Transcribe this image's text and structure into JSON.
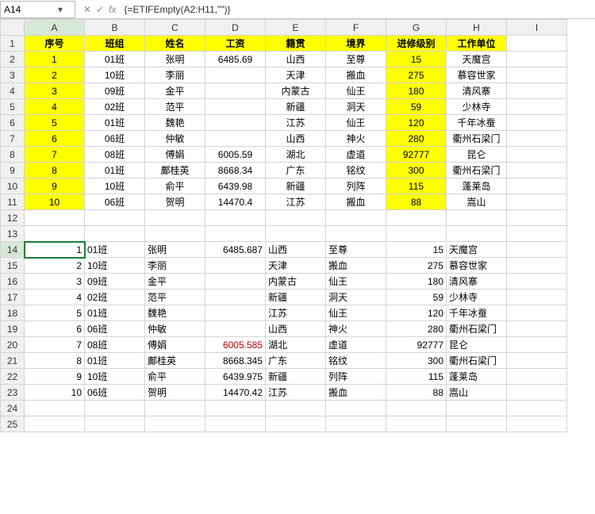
{
  "name_box": {
    "value": "A14"
  },
  "formula_bar": {
    "value": "{=ETIFEmpty(A2:H11,\"\")}"
  },
  "col_letters": [
    "A",
    "B",
    "C",
    "D",
    "E",
    "F",
    "G",
    "H",
    "I"
  ],
  "row_numbers": [
    "1",
    "2",
    "3",
    "4",
    "5",
    "6",
    "7",
    "8",
    "9",
    "10",
    "11",
    "12",
    "13",
    "14",
    "15",
    "16",
    "17",
    "18",
    "19",
    "20",
    "21",
    "22",
    "23",
    "24",
    "25"
  ],
  "header_row": [
    "序号",
    "班组",
    "姓名",
    "工资",
    "籍贯",
    "境界",
    "进修级别",
    "工作单位"
  ],
  "upper_rows": [
    [
      "1",
      "01班",
      "张明",
      "6485.69",
      "山西",
      "至尊",
      "15",
      "天魔宫"
    ],
    [
      "2",
      "10班",
      "李丽",
      "",
      "天津",
      "搬血",
      "275",
      "慕容世家"
    ],
    [
      "3",
      "09班",
      "金平",
      "",
      "内蒙古",
      "仙王",
      "180",
      "清风寨"
    ],
    [
      "4",
      "02班",
      "范平",
      "",
      "新疆",
      "洞天",
      "59",
      "少林寺"
    ],
    [
      "5",
      "01班",
      "魏艳",
      "",
      "江苏",
      "仙王",
      "120",
      "千年冰蚕"
    ],
    [
      "6",
      "06班",
      "仲敏",
      "",
      "山西",
      "神火",
      "280",
      "衢州石梁门"
    ],
    [
      "7",
      "08班",
      "傅娟",
      "6005.59",
      "湖北",
      "虚道",
      "92777",
      "昆仑"
    ],
    [
      "8",
      "01班",
      "鄺桂英",
      "8668.34",
      "广东",
      "铭纹",
      "300",
      "衢州石梁门"
    ],
    [
      "9",
      "10班",
      "俞平",
      "6439.98",
      "新疆",
      "列阵",
      "115",
      "蓬莱岛"
    ],
    [
      "10",
      "06班",
      "贺明",
      "14470.4",
      "江苏",
      "搬血",
      "88",
      "嵩山"
    ]
  ],
  "lower_rows": [
    [
      "1",
      "01班",
      "张明",
      "6485.687",
      "山西",
      "至尊",
      "15",
      "天魔宫"
    ],
    [
      "2",
      "10班",
      "李丽",
      "",
      "天津",
      "搬血",
      "275",
      "慕容世家"
    ],
    [
      "3",
      "09班",
      "金平",
      "",
      "内蒙古",
      "仙王",
      "180",
      "清风寨"
    ],
    [
      "4",
      "02班",
      "范平",
      "",
      "新疆",
      "洞天",
      "59",
      "少林寺"
    ],
    [
      "5",
      "01班",
      "魏艳",
      "",
      "江苏",
      "仙王",
      "120",
      "千年冰蚕"
    ],
    [
      "6",
      "06班",
      "仲敏",
      "",
      "山西",
      "神火",
      "280",
      "衢州石梁门"
    ],
    [
      "7",
      "08班",
      "傅娟",
      "6005.585",
      "湖北",
      "虚道",
      "92777",
      "昆仑"
    ],
    [
      "8",
      "01班",
      "鄺桂英",
      "8668.345",
      "广东",
      "铭纹",
      "300",
      "衢州石梁门"
    ],
    [
      "9",
      "10班",
      "俞平",
      "6439.975",
      "新疆",
      "列阵",
      "115",
      "蓬莱岛"
    ],
    [
      "10",
      "06班",
      "贺明",
      "14470.42",
      "江苏",
      "搬血",
      "88",
      "嵩山"
    ]
  ],
  "active_cell": {
    "row": 14,
    "col": "A"
  },
  "chart_data": {
    "type": "table",
    "title": "",
    "columns": [
      "序号",
      "班组",
      "姓名",
      "工资",
      "籍贯",
      "境界",
      "进修级别",
      "工作单位"
    ],
    "rows": [
      [
        1,
        "01班",
        "张明",
        6485.69,
        "山西",
        "至尊",
        15,
        "天魔宫"
      ],
      [
        2,
        "10班",
        "李丽",
        null,
        "天津",
        "搬血",
        275,
        "慕容世家"
      ],
      [
        3,
        "09班",
        "金平",
        null,
        "内蒙古",
        "仙王",
        180,
        "清风寨"
      ],
      [
        4,
        "02班",
        "范平",
        null,
        "新疆",
        "洞天",
        59,
        "少林寺"
      ],
      [
        5,
        "01班",
        "魏艳",
        null,
        "江苏",
        "仙王",
        120,
        "千年冰蚕"
      ],
      [
        6,
        "06班",
        "仲敏",
        null,
        "山西",
        "神火",
        280,
        "衢州石梁门"
      ],
      [
        7,
        "08班",
        "傅娟",
        6005.59,
        "湖北",
        "虚道",
        92777,
        "昆仑"
      ],
      [
        8,
        "01班",
        "鄺桂英",
        8668.34,
        "广东",
        "铭纹",
        300,
        "衢州石梁门"
      ],
      [
        9,
        "10班",
        "俞平",
        6439.98,
        "新疆",
        "列阵",
        115,
        "蓬莱岛"
      ],
      [
        10,
        "06班",
        "贺明",
        14470.4,
        "江苏",
        "搬血",
        88,
        "嵩山"
      ]
    ]
  }
}
